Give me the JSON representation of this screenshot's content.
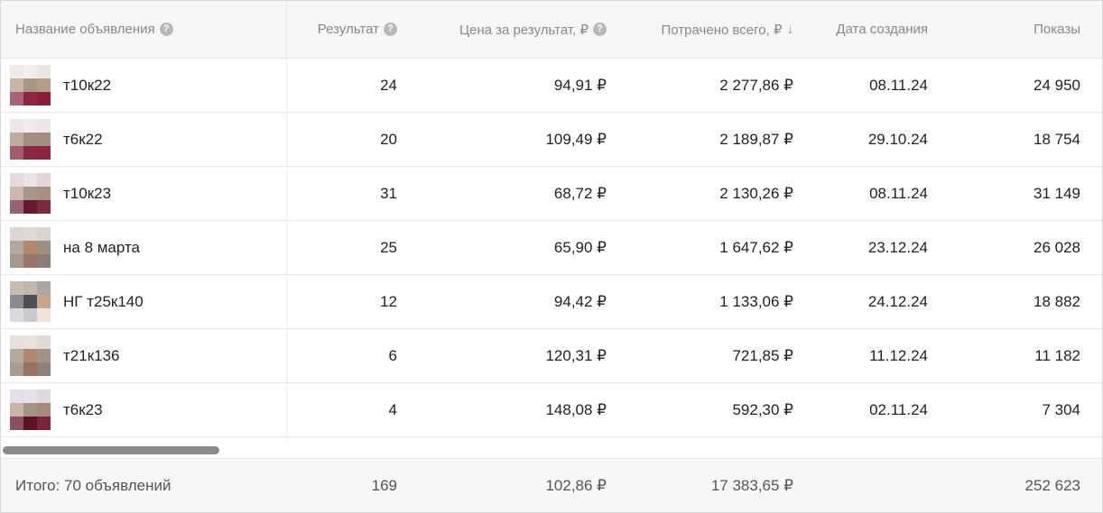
{
  "table": {
    "headers": {
      "name": "Название объявления",
      "results": "Результат",
      "price_per_result": "Цена за результат, ₽",
      "spent_total": "Потрачено всего, ₽",
      "created": "Дата создания",
      "impressions": "Показы"
    },
    "icons": {
      "help": "?",
      "sort_desc": "↓"
    },
    "rows": [
      {
        "name": "т10к22",
        "results": "24",
        "price": "94,91 ₽",
        "spent": "2 277,86 ₽",
        "created": "08.11.24",
        "impressions": "24 950"
      },
      {
        "name": "т6к22",
        "results": "20",
        "price": "109,49 ₽",
        "spent": "2 189,87 ₽",
        "created": "29.10.24",
        "impressions": "18 754"
      },
      {
        "name": "т10к23",
        "results": "31",
        "price": "68,72 ₽",
        "spent": "2 130,26 ₽",
        "created": "08.11.24",
        "impressions": "31 149"
      },
      {
        "name": "на 8 марта",
        "results": "25",
        "price": "65,90 ₽",
        "spent": "1 647,62 ₽",
        "created": "23.12.24",
        "impressions": "26 028"
      },
      {
        "name": "НГ т25к140",
        "results": "12",
        "price": "94,42 ₽",
        "spent": "1 133,06 ₽",
        "created": "24.12.24",
        "impressions": "18 882"
      },
      {
        "name": "т21к136",
        "results": "6",
        "price": "120,31 ₽",
        "spent": "721,85 ₽",
        "created": "11.12.24",
        "impressions": "11 182"
      },
      {
        "name": "т6к23",
        "results": "4",
        "price": "148,08 ₽",
        "spent": "592,30 ₽",
        "created": "02.11.24",
        "impressions": "7 304"
      }
    ],
    "footer": {
      "label": "Итого: 70 объявлений",
      "results": "169",
      "price": "102,86 ₽",
      "spent": "17 383,65 ₽",
      "impressions": "252 623"
    }
  },
  "colors": {
    "header_bg": "#f7f7f7",
    "border": "#e9e9e9",
    "scrollbar": "#8a8a8a",
    "help_icon": "#b8b8b8"
  }
}
